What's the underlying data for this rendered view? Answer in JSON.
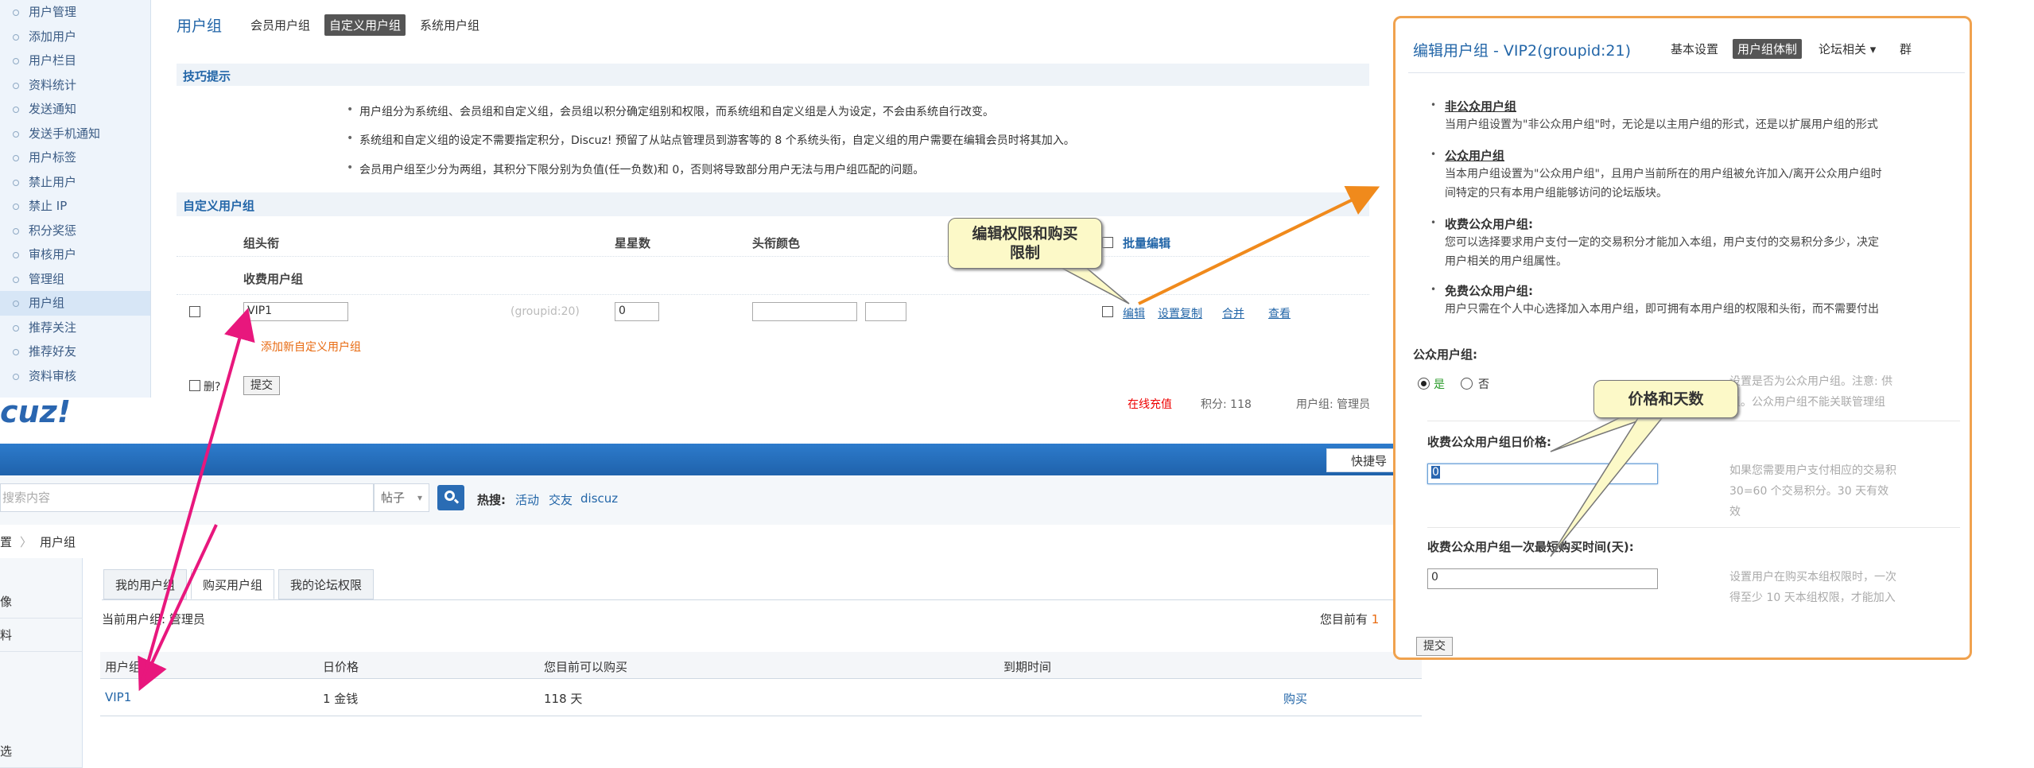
{
  "admin": {
    "sidebar": [
      "用户管理",
      "添加用户",
      "用户栏目",
      "资料统计",
      "发送通知",
      "发送手机通知",
      "用户标签",
      "禁止用户",
      "禁止 IP",
      "积分奖惩",
      "审核用户",
      "管理组",
      "用户组",
      "推荐关注",
      "推荐好友",
      "资料审核"
    ],
    "sidebar_active_index": 12,
    "page_title": "用户组",
    "tabs": [
      "会员用户组",
      "自定义用户组",
      "系统用户组"
    ],
    "tips_title": "技巧提示",
    "tips": [
      "用户组分为系统组、会员组和自定义组，会员组以积分确定组别和权限，而系统组和自定义组是人为设定，不会由系统自行改变。",
      "系统组和自定义组的设定不需要指定积分，Discuz! 预留了从站点管理员到游客等的 8 个系统头衔，自定义组的用户需要在编辑会员时将其加入。",
      "会员用户组至少分为两组，其积分下限分别为负值(任一负数)和 0，否则将导致部分用户无法与用户组匹配的问题。"
    ],
    "custom_group_title": "自定义用户组",
    "col_group_title": "组头衔",
    "col_stars": "星星数",
    "col_color": "头衔颜色",
    "bulk_edit": "批量编辑",
    "paid_group_label": "收费用户组",
    "row": {
      "name": "VIP1",
      "groupid": "(groupid:20)",
      "stars": "0",
      "color": "",
      "ops": [
        "编辑",
        "设置复制",
        "合并",
        "查看"
      ]
    },
    "add_link": "添加新自定义用户组",
    "delete_label": "删?",
    "submit": "提交"
  },
  "front": {
    "logo": "cuz!",
    "top_red": "在线充值",
    "top_points": "积分: 118",
    "top_group": "用户组: 管理员",
    "quick": "快捷导",
    "search_placeholder": "搜索内容",
    "search_type": "帖子",
    "hot_label": "热搜:",
    "hot_items": [
      "活动",
      "交友",
      "discuz"
    ],
    "breadcrumb_last": "用户组",
    "breadcrumb_prev": "置",
    "left_nav": [
      "像",
      "料",
      "选"
    ],
    "tabs": [
      "我的用户组",
      "购买用户组",
      "我的论坛权限"
    ],
    "current_group": "当前用户组: 管理员",
    "you_have": "您目前有",
    "you_have_num": "1",
    "table_headers": [
      "用户组",
      "日价格",
      "您目前可以购买",
      "到期时间"
    ],
    "row": {
      "name": "VIP1",
      "price": "1 金钱",
      "days": "118 天",
      "expire": "",
      "action": "购买"
    }
  },
  "edit": {
    "title": "编辑用户组 - VIP2(groupid:21)",
    "tabs": [
      "基本设置",
      "用户组体制",
      "论坛相关 ▾",
      "群"
    ],
    "sections": [
      {
        "title": "非公众用户组",
        "desc": [
          "当用户组设置为\"非公众用户组\"时，无论是以主用户组的形式，还是以扩展用户组的形式"
        ]
      },
      {
        "title": "公众用户组",
        "desc": [
          "当本用户组设置为\"公众用户组\"，且用户当前所在的用户组被允许加入/离开公众用户组时",
          "间特定的只有本用户组能够访问的论坛版块。"
        ]
      },
      {
        "title": "收费公众用户组:",
        "desc": [
          "您可以选择要求用户支付一定的交易积分才能加入本组，用户支付的交易积分多少，决定",
          "用户相关的用户组属性。"
        ]
      },
      {
        "title": "免费公众用户组:",
        "desc": [
          "用户只需在个人中心选择加入本用户组，即可拥有本用户组的权限和头衔，而不需要付出"
        ]
      }
    ],
    "public_label": "公众用户组:",
    "yes": "是",
    "no": "否",
    "public_help": [
      "设置是否为公众用户组。注意: 供",
      "组。公众用户组不能关联管理组"
    ],
    "price_label": "收费公众用户组日价格:",
    "price_value": "0",
    "price_help": [
      "如果您需要用户支付相应的交易积",
      "30=60 个交易积分。30 天有效",
      "效"
    ],
    "mindays_label": "收费公众用户组一次最短购买时间(天):",
    "mindays_value": "0",
    "mindays_help": [
      "设置用户在购买本组权限时，一次",
      "得至少 10 天本组权限，才能加入"
    ],
    "submit": "提交"
  },
  "callouts": {
    "edit_callout": [
      "编辑权限和购买",
      "限制"
    ],
    "price_callout": "价格和天数"
  },
  "colors": {
    "link": "#2366a8",
    "accent_orange": "#e86a10",
    "arrow_pink": "#e8177d",
    "arrow_orange": "#f08a1c",
    "panel_border": "#f0a24e"
  }
}
